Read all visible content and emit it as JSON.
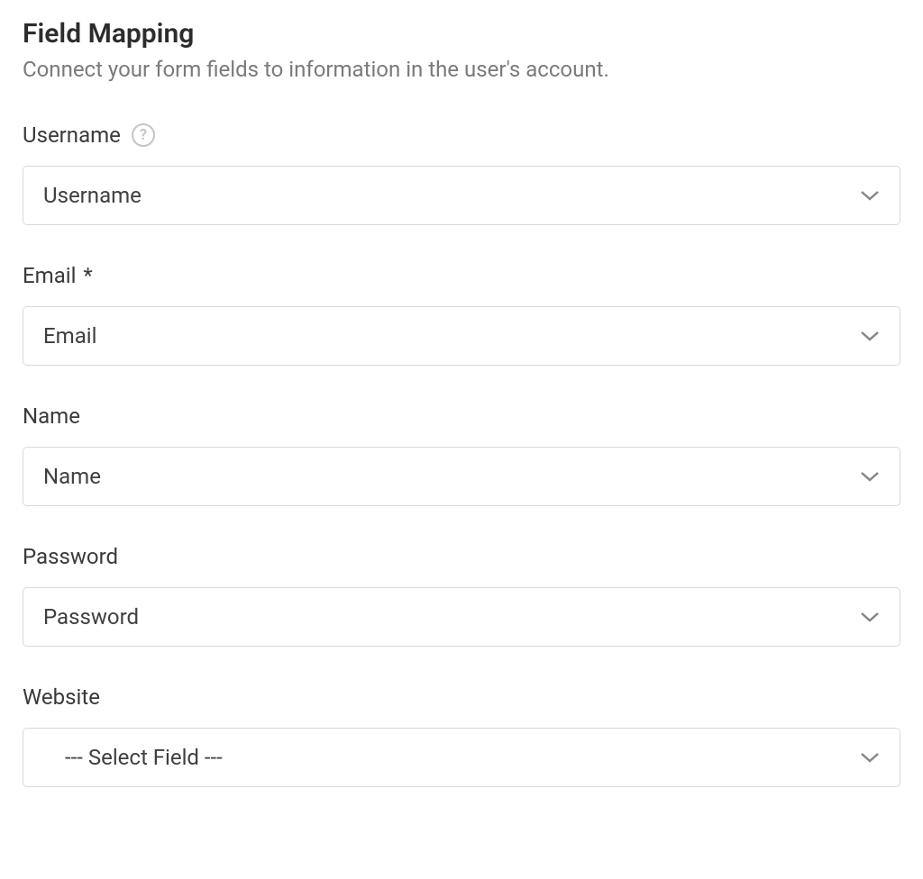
{
  "header": {
    "title": "Field Mapping",
    "subtitle": "Connect your form fields to information in the user's account."
  },
  "fields": {
    "username": {
      "label": "Username",
      "has_help": true,
      "value": "Username"
    },
    "email": {
      "label": "Email",
      "required": true,
      "value": "Email"
    },
    "name": {
      "label": "Name",
      "value": "Name"
    },
    "password": {
      "label": "Password",
      "value": "Password"
    },
    "website": {
      "label": "Website",
      "value": "--- Select Field ---"
    }
  }
}
